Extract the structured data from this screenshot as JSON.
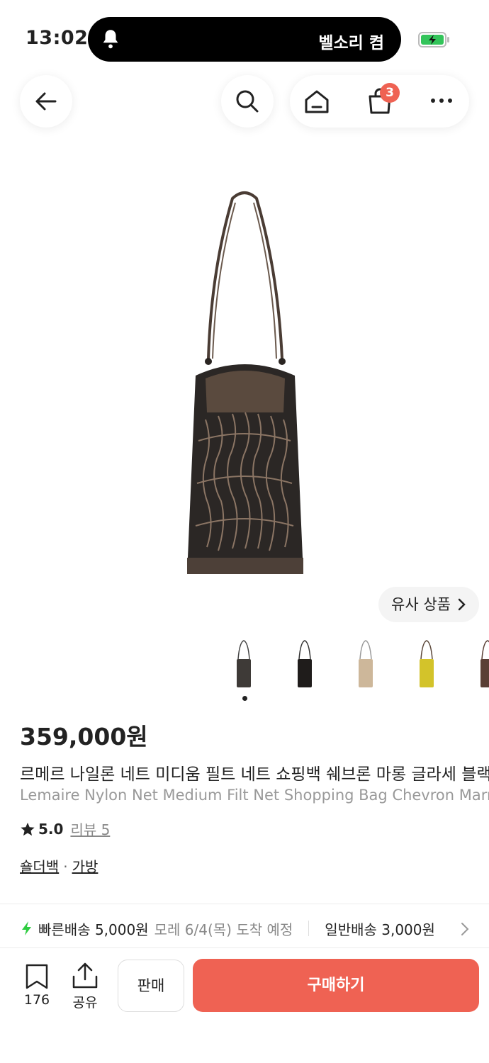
{
  "status_bar": {
    "time": "13:02",
    "notification_text": "벨소리 켬",
    "icons": [
      "bell-icon",
      "battery-charging-icon"
    ]
  },
  "nav": {
    "cart_count": "3",
    "icons": [
      "back-arrow-icon",
      "search-icon",
      "home-icon",
      "shopping-bag-icon",
      "more-icon"
    ]
  },
  "product": {
    "similar_label": "유사 상품",
    "price": "359,000원",
    "title_ko": "르메르 나일론 네트 미디움 필트 네트 쇼핑백 쉐브론 마롱 글라세 블랙",
    "title_en": "Lemaire Nylon Net Medium Filt Net Shopping Bag Chevron Marron Glace Black",
    "rating": "5.0",
    "review_label": "리뷰 5",
    "categories": [
      "숄더백",
      "가방"
    ],
    "category_separator": "·",
    "thumbnail_count": 5,
    "active_thumbnail": 1,
    "thumbnail_colors": [
      "#3e3a37",
      "#1f1c1b",
      "#cdb79a",
      "#d3c32a",
      "#5a3f35"
    ]
  },
  "shipping": {
    "fast_label": "빠른배송 5,000원",
    "fast_date": "모레 6/4(목) 도착 예정",
    "normal_label": "일반배송 3,000원"
  },
  "bottom_bar": {
    "bookmark_count": "176",
    "share_label": "공유",
    "sell_label": "판매",
    "buy_label": "구매하기"
  },
  "colors": {
    "accent": "#ef6253",
    "fast_delivery": "#2ecc40"
  }
}
